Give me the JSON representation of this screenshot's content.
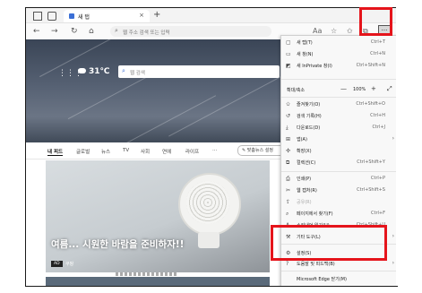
{
  "tab": {
    "title": "새 탭",
    "close": "×",
    "new_tab": "+"
  },
  "nav": {
    "back": "←",
    "forward": "→",
    "refresh": "↻",
    "home": "⌂"
  },
  "address": {
    "placeholder": "웹 주소 검색 또는 입력"
  },
  "more_button": "···",
  "hero": {
    "weather_temp": "31℃",
    "search_placeholder": "웹 검색"
  },
  "feed": {
    "tabs": [
      "내 피드",
      "글로벌",
      "뉴스",
      "TV",
      "사회",
      "연예",
      "라이프",
      "···"
    ],
    "active_tab": "내 피드",
    "custom_button": "✎ 맞춤뉴스 설정"
  },
  "card": {
    "headline": "여름... 시원한 바람을 준비하자!!",
    "source_badge": "AD",
    "source_name": "쿠팡"
  },
  "menu": {
    "items_top": [
      {
        "icon": "new-tab",
        "label": "새 탭(T)",
        "shortcut": "Ctrl+T"
      },
      {
        "icon": "new-window",
        "label": "새 창(N)",
        "shortcut": "Ctrl+N"
      },
      {
        "icon": "inprivate",
        "label": "새 InPrivate 창(I)",
        "shortcut": "Ctrl+Shift+N"
      }
    ],
    "zoom": {
      "label": "확대/축소",
      "minus": "—",
      "value": "100%",
      "plus": "+",
      "fullscreen": "⤢"
    },
    "items_mid": [
      {
        "icon": "favorites",
        "label": "즐겨찾기(O)",
        "shortcut": "Ctrl+Shift+O"
      },
      {
        "icon": "history",
        "label": "검색 기록(H)",
        "shortcut": "Ctrl+H"
      },
      {
        "icon": "downloads",
        "label": "다운로드(D)",
        "shortcut": "Ctrl+J"
      },
      {
        "icon": "apps",
        "label": "앱(A)",
        "arrow": "›"
      },
      {
        "icon": "extensions",
        "label": "확장(X)"
      },
      {
        "icon": "collections",
        "label": "컬렉션(C)",
        "shortcut": "Ctrl+Shift+Y"
      }
    ],
    "items_low": [
      {
        "icon": "print",
        "label": "인쇄(P)",
        "shortcut": "Ctrl+P"
      },
      {
        "icon": "web-capture",
        "label": "웹 캡처(R)",
        "shortcut": "Ctrl+Shift+S"
      },
      {
        "icon": "share",
        "label": "공유(R)",
        "dim": true
      },
      {
        "icon": "find",
        "label": "페이지에서 찾기(F)",
        "shortcut": "Ctrl+F"
      },
      {
        "icon": "read-aloud",
        "label": "소리내어 읽기(U)",
        "shortcut": "Ctrl+Shift+U"
      }
    ],
    "items_bottom": [
      {
        "icon": "more-tools",
        "label": "기타 도구(L)",
        "arrow": "›"
      },
      {
        "icon": "settings",
        "label": "설정(S)"
      },
      {
        "icon": "help",
        "label": "도움말 및 피드백(B)",
        "arrow": "›"
      }
    ],
    "close_edge": "Microsoft Edge 닫기(M)"
  },
  "colors": {
    "highlight": "#e5141b",
    "accent": "#3b6fd6"
  }
}
